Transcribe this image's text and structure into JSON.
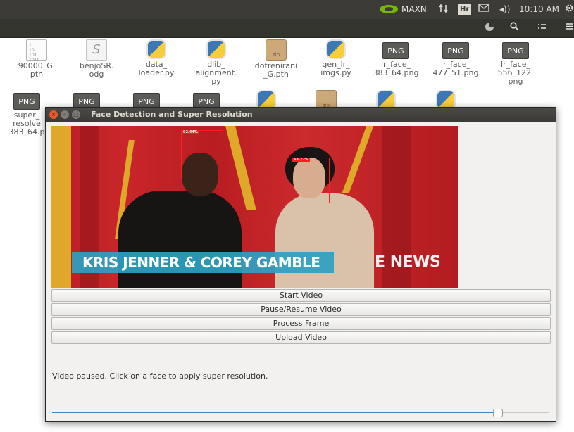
{
  "topbar": {
    "nvidia_label": "MAXN",
    "keyboard_label": "Hr",
    "volume_symbol": "◂))",
    "clock": "10:10 AM"
  },
  "files_row1": [
    {
      "name": "90000_G.\npth",
      "kind": "text"
    },
    {
      "name": "benjoSR.\nodg",
      "kind": "odg"
    },
    {
      "name": "data_\nloader.py",
      "kind": "py"
    },
    {
      "name": "dlib_\nalignment.\npy",
      "kind": "py"
    },
    {
      "name": "dotrenirani\n_G.pth",
      "kind": "zip"
    },
    {
      "name": "gen_lr_\nimgs.py",
      "kind": "py"
    },
    {
      "name": "lr_face_\n383_64.png",
      "kind": "png"
    },
    {
      "name": "lr_face_\n477_51.png",
      "kind": "png"
    },
    {
      "name": "lr_face_\n556_122.\npng",
      "kind": "png"
    }
  ],
  "files_row2": [
    {
      "name": "super_\nresolve\n383_64.p",
      "kind": "png"
    },
    {
      "name": "",
      "kind": "png"
    },
    {
      "name": "",
      "kind": "png"
    },
    {
      "name": "",
      "kind": "png"
    },
    {
      "name": "",
      "kind": "py"
    },
    {
      "name": "",
      "kind": "zip"
    },
    {
      "name": "",
      "kind": "py"
    },
    {
      "name": "",
      "kind": "py"
    }
  ],
  "icon_labels": {
    "png": "PNG",
    "zip": "zip",
    "text": "1\n10\n101\n1010",
    "odg": "S"
  },
  "window": {
    "title": "Face Detection and Super Resolution",
    "close_symbol": "×",
    "min_symbol": "–",
    "max_symbol": "□"
  },
  "video": {
    "caption": "KRIS JENNER & COREY GAMBLE",
    "logo": "E NEWS",
    "faces": [
      {
        "confidence": "92.44%"
      },
      {
        "confidence": "63.72%"
      }
    ]
  },
  "buttons": {
    "start": "Start Video",
    "pause": "Pause/Resume Video",
    "process": "Process Frame",
    "upload": "Upload Video"
  },
  "status": "Video paused. Click on a face to apply super resolution.",
  "progress": {
    "fraction": 0.895
  },
  "colors": {
    "panel": "#3c3b37",
    "accent": "#3e86c7",
    "face_box": "#ff1f1f",
    "caption_bar": "#2ea1c2",
    "close_button": "#e55a2c"
  }
}
